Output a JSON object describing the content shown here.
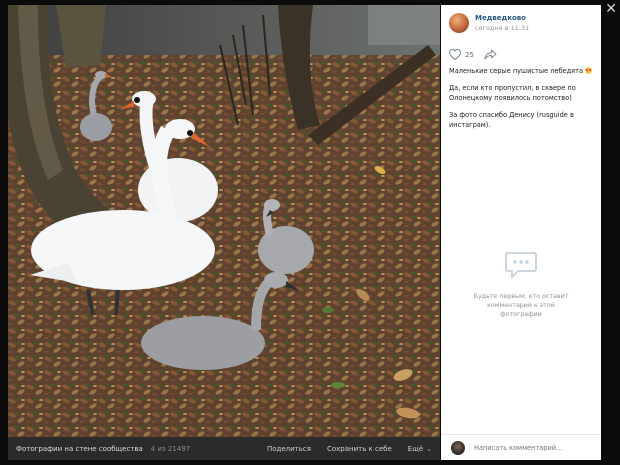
{
  "window": {
    "close_label": "✕"
  },
  "post": {
    "author": "Медведково",
    "date": "сегодня в 11:31",
    "likes": "25",
    "text": [
      "Маленькие серые пушистые лебедята",
      "Да, если кто пропустил, в сквере по Олонецкому появилось потомство)",
      "За фото спасибо Денису (rusguide в инстаграм)."
    ]
  },
  "comments": {
    "empty_text": "Будьте первым, кто оставит комментарий к этой фотографии",
    "input_placeholder": "Написать комментарий..."
  },
  "photo_footer": {
    "album": "Фотографии на стене сообщества",
    "counter": "4 из 21497",
    "share": "Поделиться",
    "save": "Сохранить к себе",
    "more": "Ещё"
  },
  "colors": {
    "link": "#2a5885",
    "muted": "#939393",
    "footer_bg": "#2b2b2b"
  }
}
